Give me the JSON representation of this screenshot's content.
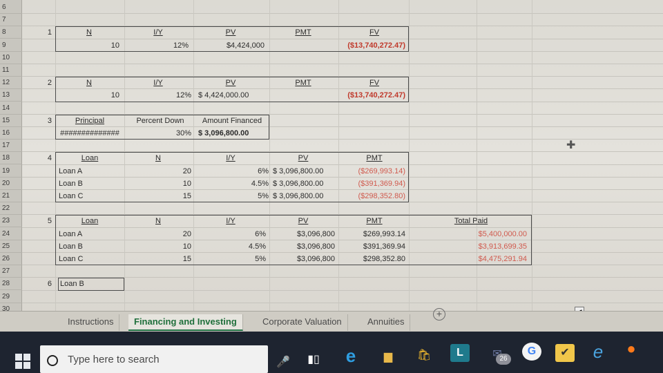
{
  "rows": [
    "6",
    "7",
    "8",
    "9",
    "10",
    "11",
    "12",
    "13",
    "14",
    "15",
    "16",
    "17",
    "18",
    "19",
    "20",
    "21",
    "22",
    "23",
    "24",
    "25",
    "26",
    "27",
    "28",
    "29",
    "30"
  ],
  "s1": {
    "num": "1",
    "n": "N",
    "iy": "I/Y",
    "pv": "PV",
    "pmt": "PMT",
    "fv": "FV",
    "n_val": "10",
    "iy_val": "12%",
    "pv_val": "$4,424,000",
    "fv_val": "($13,740,272.47)"
  },
  "s2": {
    "num": "2",
    "n": "N",
    "iy": "I/Y",
    "pv": "PV",
    "pmt": "PMT",
    "fv": "FV",
    "n_val": "10",
    "iy_val": "12%",
    "pv_val": "$  4,424,000.00",
    "fv_val": "($13,740,272.47)"
  },
  "s3": {
    "num": "3",
    "principal": "Principal",
    "principal_val": "##############",
    "pct_down": "Percent Down",
    "pct_down_val": "30%",
    "amt_fin": "Amount Financed",
    "amt_fin_val": "$  3,096,800.00"
  },
  "s4": {
    "num": "4",
    "loan": "Loan",
    "n": "N",
    "iy": "I/Y",
    "pv": "PV",
    "pmt": "PMT",
    "rows": [
      {
        "name": "Loan A",
        "n": "20",
        "iy": "6%",
        "pv": "$  3,096,800.00",
        "pmt": "($269,993.14)"
      },
      {
        "name": "Loan B",
        "n": "10",
        "iy": "4.5%",
        "pv": "$  3,096,800.00",
        "pmt": "($391,369.94)"
      },
      {
        "name": "Loan C",
        "n": "15",
        "iy": "5%",
        "pv": "$  3,096,800.00",
        "pmt": "($298,352.80)"
      }
    ]
  },
  "s5": {
    "num": "5",
    "loan": "Loan",
    "n": "N",
    "iy": "I/Y",
    "pv": "PV",
    "pmt": "PMT",
    "total": "Total Paid",
    "rows": [
      {
        "name": "Loan A",
        "n": "20",
        "iy": "6%",
        "pv": "$3,096,800",
        "pmt": "$269,993.14",
        "total": "$5,400,000.00"
      },
      {
        "name": "Loan B",
        "n": "10",
        "iy": "4.5%",
        "pv": "$3,096,800",
        "pmt": "$391,369.94",
        "total": "$3,913,699.35"
      },
      {
        "name": "Loan C",
        "n": "15",
        "iy": "5%",
        "pv": "$3,096,800",
        "pmt": "$298,352.80",
        "total": "$4,475,291.94"
      }
    ]
  },
  "s6": {
    "num": "6",
    "answer": "Loan B"
  },
  "tabs": [
    "Instructions",
    "Financing and Investing",
    "Corporate Valuation",
    "Annuities"
  ],
  "add_sheet": "+",
  "taskbar": {
    "search_placeholder": "Type here to search",
    "badge": "26",
    "l_label": "L",
    "e_label": "e"
  },
  "colors": {
    "red": "#c0392b",
    "excel_green": "#217346",
    "taskbar": "#1e2430"
  }
}
